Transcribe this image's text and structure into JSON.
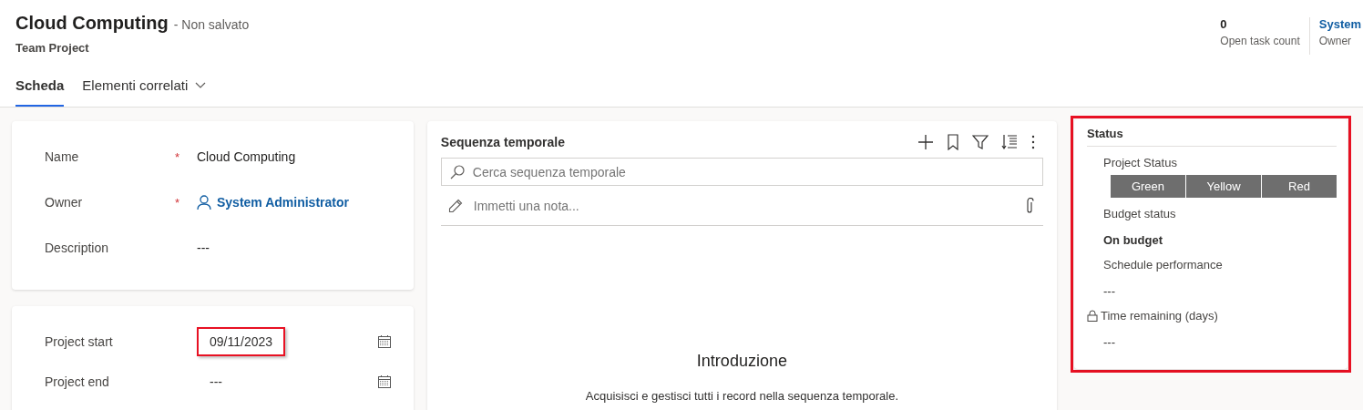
{
  "header": {
    "title": "Cloud Computing",
    "save_state": "- Non salvato",
    "entity": "Team Project",
    "fields": [
      {
        "value": "0",
        "label": "Open task count",
        "kind": "text"
      },
      {
        "value": "System",
        "label": "Owner",
        "kind": "link"
      }
    ]
  },
  "tabs": [
    {
      "label": "Scheda",
      "selected": true
    },
    {
      "label": "Elementi correlati",
      "selected": false
    }
  ],
  "general": {
    "fields": [
      {
        "label": "Name",
        "required_mark": "*",
        "value": "Cloud Computing",
        "kind": "text"
      },
      {
        "label": "Owner",
        "required_mark": "*",
        "value": "System Administrator",
        "kind": "lookup"
      },
      {
        "label": "Description",
        "value": "---",
        "kind": "text"
      }
    ]
  },
  "dates": {
    "fields": [
      {
        "label": "Project start",
        "value": "09/11/2023",
        "highlighted": true
      },
      {
        "label": "Project end",
        "value": "---",
        "highlighted": false
      }
    ]
  },
  "timeline": {
    "title": "Sequenza temporale",
    "search": {
      "placeholder": "Cerca sequenza temporale"
    },
    "note": {
      "placeholder": "Immetti una nota..."
    },
    "empty_title": "Introduzione",
    "empty_text": "Acquisisci e gestisci tutti i record nella sequenza temporale."
  },
  "status": {
    "title": "Status",
    "highlighted": true,
    "project_status": {
      "label": "Project Status",
      "options": [
        {
          "label": "Green",
          "selected": false
        },
        {
          "label": "Yellow",
          "selected": false
        },
        {
          "label": "Red",
          "selected": false
        }
      ]
    },
    "fields": [
      {
        "label": "Budget status",
        "value": "On budget",
        "locked": false,
        "bold": true
      },
      {
        "label": "Schedule performance",
        "value": "---",
        "locked": false,
        "bold": false
      },
      {
        "label": "Time remaining (days)",
        "value": "---",
        "locked": true,
        "bold": false
      }
    ]
  }
}
